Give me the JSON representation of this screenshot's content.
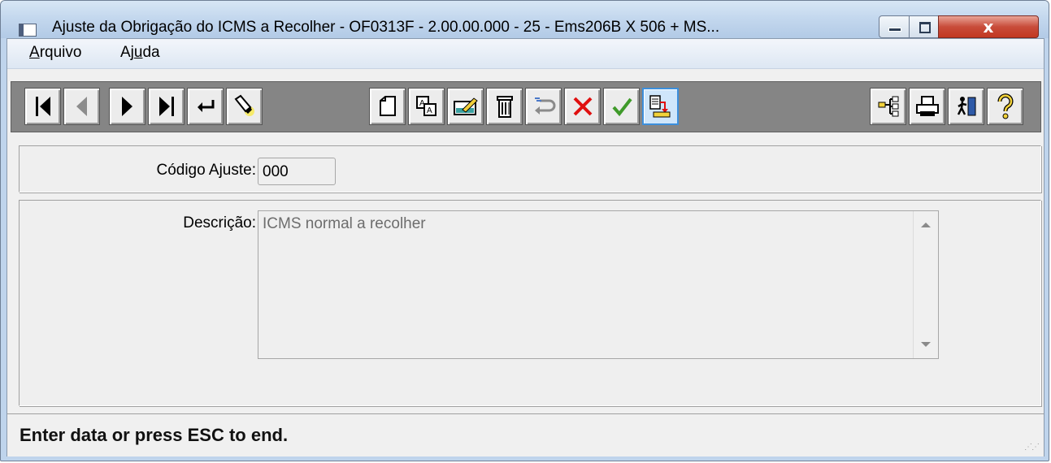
{
  "window": {
    "title": "Ajuste da Obrigação do ICMS a Recolher - OF0313F - 2.00.00.000 - 25 - Ems206B X 506 + MS...",
    "close_symbol": "x"
  },
  "menu": {
    "items": [
      {
        "label": "Arquivo",
        "mnemonic_index": 0
      },
      {
        "label": "Ajuda",
        "mnemonic_index": 2
      }
    ]
  },
  "toolbar": {
    "buttons": [
      {
        "name": "first-record",
        "icon": "first-icon"
      },
      {
        "name": "previous-record",
        "icon": "previous-icon",
        "disabled": true
      },
      {
        "name": "next-record",
        "icon": "next-icon"
      },
      {
        "name": "last-record",
        "icon": "last-icon"
      },
      {
        "name": "goto-record",
        "icon": "return-arrow-icon"
      },
      {
        "name": "search",
        "icon": "flashlight-icon"
      },
      {
        "name": "new",
        "icon": "new-document-icon"
      },
      {
        "name": "copy",
        "icon": "copy-icon"
      },
      {
        "name": "edit",
        "icon": "edit-icon"
      },
      {
        "name": "delete",
        "icon": "trash-icon"
      },
      {
        "name": "undo",
        "icon": "undo-icon"
      },
      {
        "name": "cancel",
        "icon": "red-x-icon"
      },
      {
        "name": "save",
        "icon": "green-check-icon"
      },
      {
        "name": "related",
        "icon": "zoom-list-icon",
        "active": true
      },
      {
        "name": "query",
        "icon": "tree-icon"
      },
      {
        "name": "print",
        "icon": "printer-icon"
      },
      {
        "name": "exit",
        "icon": "exit-door-icon"
      },
      {
        "name": "help",
        "icon": "question-icon"
      }
    ]
  },
  "form": {
    "code_label": "Código Ajuste:",
    "code_value": "000",
    "description_label": "Descrição:",
    "description_value": "ICMS normal a recolher"
  },
  "status": {
    "message": "Enter data or press ESC to end."
  },
  "colors": {
    "title_bar": "#c4d8ee",
    "toolbar_bg": "#858585",
    "close_button": "#c84c3a",
    "active_button_border": "#3c8fdc"
  }
}
